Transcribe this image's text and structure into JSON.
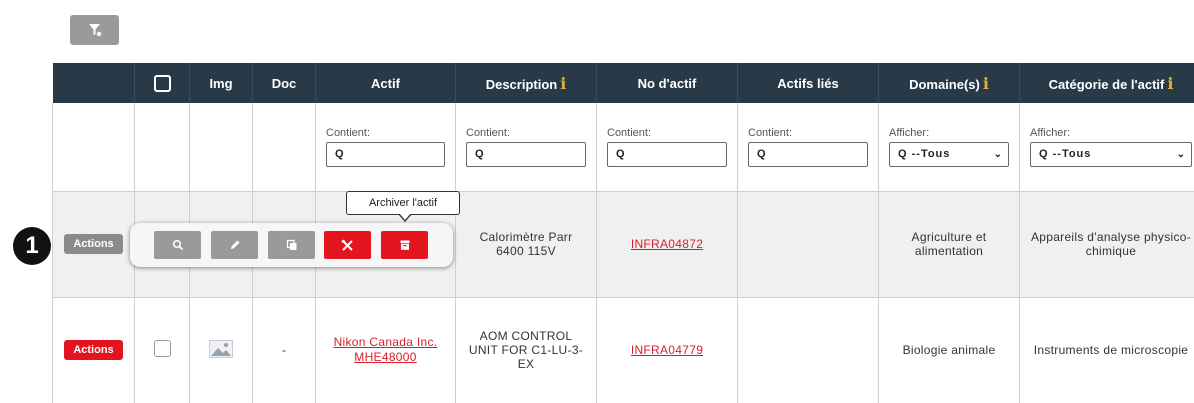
{
  "toolbar_top": {
    "filter_icon": "filter-clear-icon"
  },
  "table": {
    "headers": {
      "img": "Img",
      "doc": "Doc",
      "actif": "Actif",
      "description": "Description",
      "no_actif": "No d'actif",
      "actifs_lies": "Actifs liés",
      "domaines": "Domaine(s)",
      "categorie": "Catégorie de l'actif",
      "info_glyph": "i"
    },
    "filters": {
      "actif": {
        "label": "Contient:",
        "value": "Q"
      },
      "description": {
        "label": "Contient:",
        "value": "Q"
      },
      "no_actif": {
        "label": "Contient:",
        "value": "Q"
      },
      "actifs_lies": {
        "label": "Contient:",
        "value": "Q"
      },
      "domaines": {
        "label": "Afficher:",
        "value": "Q --Tous"
      },
      "categorie": {
        "label": "Afficher:",
        "value": "Q --Tous"
      }
    },
    "rows": [
      {
        "actions_label": "Actions",
        "description": "Calorimètre Parr 6400 115V",
        "no_actif": "INFRA04872",
        "domaine": "Agriculture et alimentation",
        "categorie": "Appareils d'analyse physico-chimique"
      },
      {
        "actions_label": "Actions",
        "doc": "-",
        "actif": "Nikon Canada Inc. MHE48000",
        "description": "AOM CONTROL UNIT FOR C1-LU-3-EX",
        "no_actif": "INFRA04779",
        "domaine": "Biologie animale",
        "categorie": "Instruments de microscopie"
      }
    ]
  },
  "action_toolbar": {
    "tooltip": "Archiver l'actif",
    "buttons": [
      "search-icon",
      "pencil-icon",
      "copy-icon",
      "tools-icon",
      "archive-icon"
    ]
  },
  "annotation": {
    "marker": "1"
  },
  "colors": {
    "header_bg": "#283a47",
    "accent_red": "#e4141f",
    "info_gold": "#e0b233",
    "button_grey": "#9a9a9a"
  }
}
